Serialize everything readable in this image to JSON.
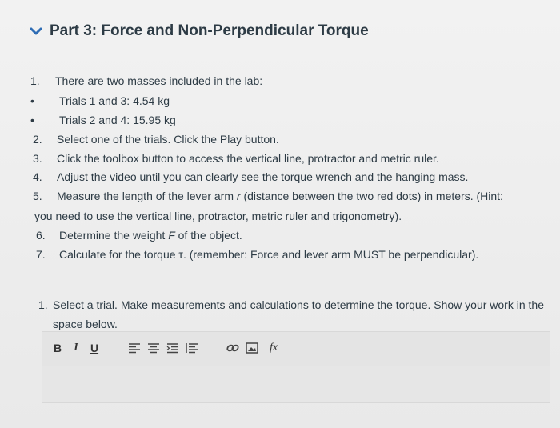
{
  "header": {
    "title": "Part 3: Force and Non-Perpendicular Torque",
    "icon": "chevron-down-icon",
    "accent": "#2f6db5"
  },
  "steps": [
    {
      "marker": "1.",
      "text": "There are two masses included in the lab:"
    },
    {
      "marker": "•",
      "text": "Trials 1 and 3: 4.54 kg"
    },
    {
      "marker": "•",
      "text": "Trials 2 and 4: 15.95 kg"
    },
    {
      "marker": "2.",
      "text": "Select one of the trials. Click the Play button."
    },
    {
      "marker": "3.",
      "text": "Click the toolbox button to access the vertical line, protractor and metric ruler."
    },
    {
      "marker": "4.",
      "text": "Adjust the video until you can clearly see the torque wrench and the hanging mass."
    },
    {
      "marker": "5.",
      "text_a": "Measure the length of the lever arm ",
      "var": "r",
      "text_b": " (distance between the two red dots) in meters. (Hint:"
    },
    {
      "text": "you need to use the vertical line, protractor, metric ruler and trigonometry)."
    },
    {
      "marker": "6.",
      "text_a": "Determine the weight ",
      "var": "F",
      "text_b": " of the object."
    },
    {
      "marker": "7.",
      "text": "Calculate for the torque τ. (remember: Force and lever arm MUST be perpendicular)."
    }
  ],
  "question": {
    "number": "1.",
    "text": "Select a trial. Make measurements and calculations  to determine the torque. Show your work in the space below."
  },
  "toolbar": {
    "bold": "B",
    "italic": "I",
    "underline": "U",
    "formula": "fx"
  }
}
